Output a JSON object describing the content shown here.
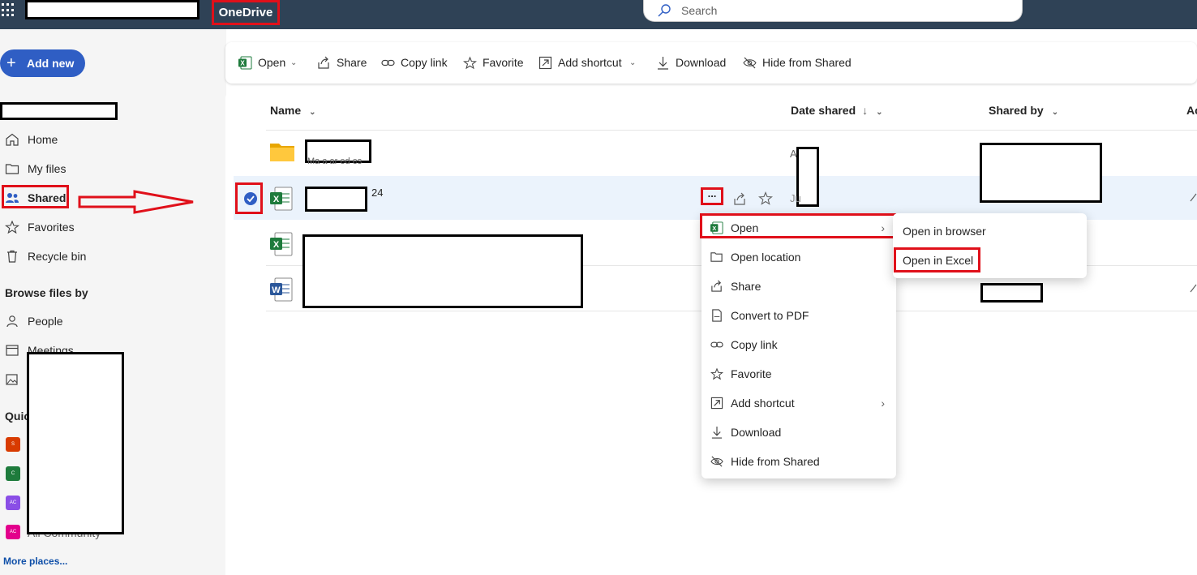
{
  "app": {
    "brand": "OneDrive"
  },
  "search": {
    "placeholder": "Search"
  },
  "sidebar": {
    "add_new": "Add new",
    "nav": [
      {
        "label": "Home",
        "icon": "home-icon"
      },
      {
        "label": "My files",
        "icon": "folder-icon"
      },
      {
        "label": "Shared",
        "icon": "people-icon"
      },
      {
        "label": "Favorites",
        "icon": "star-icon"
      },
      {
        "label": "Recycle bin",
        "icon": "trash-icon"
      }
    ],
    "browse_heading": "Browse files by",
    "browse": [
      {
        "label": "People",
        "icon": "person-icon"
      },
      {
        "label": "Meetings",
        "icon": "calendar-icon"
      }
    ],
    "quick_access_heading": "Quic",
    "quick_access": [
      {
        "badge": "S",
        "color": "#d83b01"
      },
      {
        "badge": "C",
        "color": "#1e7b3c"
      },
      {
        "badge": "AC",
        "color": "#8a4ee6"
      },
      {
        "badge": "AC",
        "color": "#e3008c",
        "label": "All Community"
      }
    ],
    "more_places": "More places..."
  },
  "commandbar": {
    "open": "Open",
    "share": "Share",
    "copy_link": "Copy link",
    "favorite": "Favorite",
    "add_shortcut": "Add shortcut",
    "download": "Download",
    "hide_from_shared": "Hide from Shared"
  },
  "columns": {
    "name": "Name",
    "date_shared": "Date shared",
    "shared_by": "Shared by",
    "activity": "Ac"
  },
  "rows": [
    {
      "type": "folder",
      "subtitle": "Ma  a  ar  ed  es",
      "date": "A        0"
    },
    {
      "type": "excel",
      "name_suffix": "24",
      "date": "Ju",
      "selected": true
    },
    {
      "type": "excel"
    },
    {
      "type": "word"
    }
  ],
  "context_menu": {
    "items": [
      {
        "label": "Open",
        "icon": "excel-icon",
        "submenu": true
      },
      {
        "label": "Open location",
        "icon": "folder-location-icon"
      },
      {
        "label": "Share",
        "icon": "share-icon"
      },
      {
        "label": "Convert to PDF",
        "icon": "pdf-icon"
      },
      {
        "label": "Copy link",
        "icon": "link-icon"
      },
      {
        "label": "Favorite",
        "icon": "star-icon"
      },
      {
        "label": "Add shortcut",
        "icon": "shortcut-icon",
        "submenu": true
      },
      {
        "label": "Download",
        "icon": "download-icon"
      },
      {
        "label": "Hide from Shared",
        "icon": "hide-icon"
      }
    ],
    "submenu": {
      "open_in_browser": "Open in browser",
      "open_in_excel": "Open in Excel"
    }
  },
  "more_button": "...",
  "colors": {
    "accent": "#2f5ec4",
    "topbar": "#2f4256",
    "highlight": "#e0101a",
    "excel": "#1e7b3c",
    "word": "#2b579a"
  }
}
